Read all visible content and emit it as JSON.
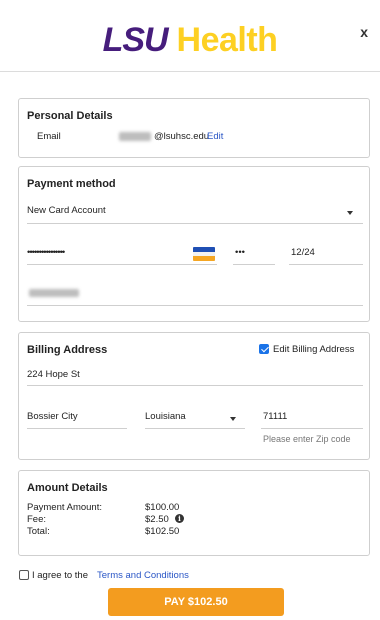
{
  "header": {
    "logo_lsu": "LSU",
    "logo_health": "Health",
    "close_label": "x"
  },
  "personal": {
    "title": "Personal Details",
    "email_label": "Email",
    "email_domain": "@lsuhsc.edu",
    "edit_label": "Edit"
  },
  "payment": {
    "title": "Payment method",
    "method_value": "New Card Account",
    "card_number_masked": "••••••••••••••••",
    "cvv_masked": "•••",
    "expiry": "12/24"
  },
  "billing": {
    "title": "Billing Address",
    "edit_checkbox_label": "Edit Billing Address",
    "edit_checked": true,
    "street": "224 Hope St",
    "city": "Bossier City",
    "state": "Louisiana",
    "zip": "71111",
    "zip_hint": "Please enter Zip code"
  },
  "amount": {
    "title": "Amount Details",
    "rows": [
      {
        "label": "Payment Amount:",
        "value": "$100.00"
      },
      {
        "label": "Fee:",
        "value": "$2.50"
      },
      {
        "label": "Total:",
        "value": "$102.50"
      }
    ]
  },
  "terms": {
    "prefix": "I agree to the",
    "link": "Terms and Conditions",
    "checked": false
  },
  "pay_button": "PAY $102.50",
  "colors": {
    "lsu_purple": "#461d7c",
    "lsu_gold": "#fdd023",
    "pay_orange": "#f39c1f",
    "link_blue": "#2a56c6",
    "checkbox_blue": "#1a73e8"
  }
}
